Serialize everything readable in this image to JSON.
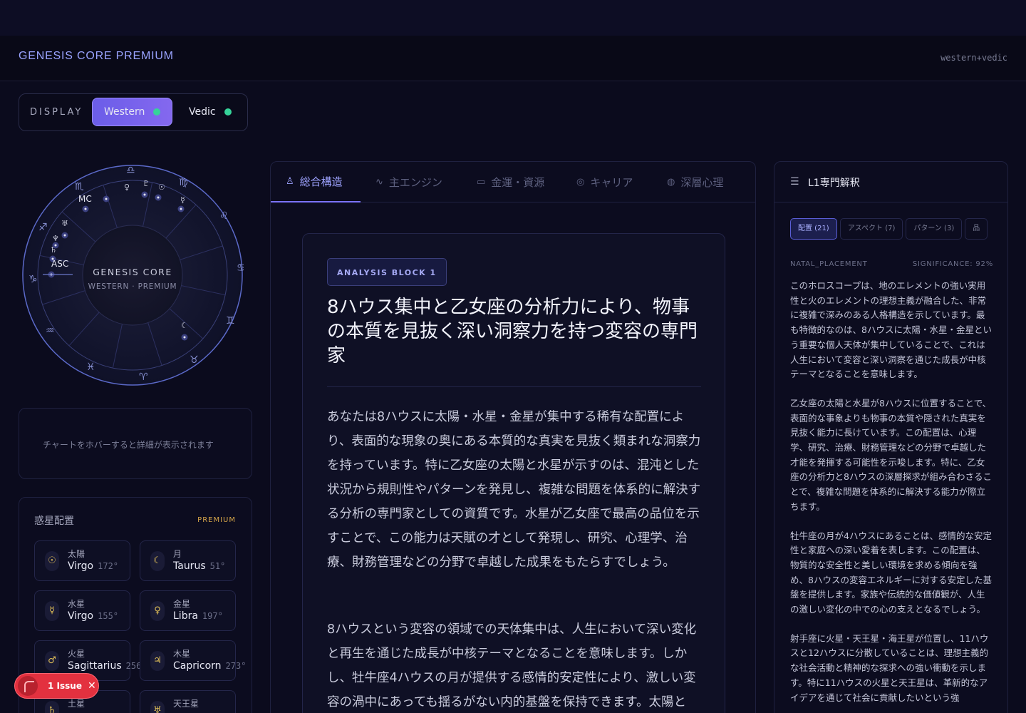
{
  "header": {
    "brand": "GENESIS CORE PREMIUM",
    "mode_tag": "western+vedic"
  },
  "display": {
    "label": "DISPLAY",
    "options": [
      {
        "label": "Western",
        "active": true
      },
      {
        "label": "Vedic",
        "active": false
      }
    ],
    "dot_color": "#36d399"
  },
  "wheel": {
    "center_title": "GENESIS CORE",
    "center_subtitle": "WESTERN · PREMIUM",
    "asc_label": "ASC",
    "mc_label": "MC",
    "signs": [
      "♎",
      "♍",
      "♌",
      "♋",
      "♊",
      "♉",
      "♈",
      "♓",
      "♒",
      "♑",
      "♐",
      "♏"
    ],
    "planet_glyphs": [
      "♀",
      "♇",
      "☉",
      "☿",
      "♅",
      "♆",
      "♄",
      "☾"
    ]
  },
  "hover_hint": "チャートをホバーすると詳細が表示されます",
  "planets": {
    "title": "惑星配置",
    "badge": "PREMIUM",
    "items": [
      {
        "glyph": "☉",
        "name": "太陽",
        "sign": "Virgo",
        "degree": "172°"
      },
      {
        "glyph": "☾",
        "name": "月",
        "sign": "Taurus",
        "degree": "51°"
      },
      {
        "glyph": "☿",
        "name": "水星",
        "sign": "Virgo",
        "degree": "155°"
      },
      {
        "glyph": "♀",
        "name": "金星",
        "sign": "Libra",
        "degree": "197°"
      },
      {
        "glyph": "♂",
        "name": "火星",
        "sign": "Sagittarius",
        "degree": "256°"
      },
      {
        "glyph": "♃",
        "name": "木星",
        "sign": "Capricorn",
        "degree": "273°"
      },
      {
        "glyph": "♄",
        "name": "土星",
        "sign": "",
        "degree": ""
      },
      {
        "glyph": "♅",
        "name": "天王星",
        "sign": "",
        "degree": ""
      }
    ]
  },
  "issue": {
    "label": "1 Issue",
    "close": "✕"
  },
  "tabs": [
    {
      "icon": "person-icon",
      "glyph": "♙",
      "label": "総合構造",
      "active": true
    },
    {
      "icon": "activity-icon",
      "glyph": "∿",
      "label": "主エンジン",
      "active": false
    },
    {
      "icon": "wallet-icon",
      "glyph": "▭",
      "label": "金運・資源",
      "active": false
    },
    {
      "icon": "target-icon",
      "glyph": "◎",
      "label": "キャリア",
      "active": false
    },
    {
      "icon": "brain-icon",
      "glyph": "◍",
      "label": "深層心理",
      "active": false
    }
  ],
  "article": {
    "badge": "ANALYSIS BLOCK 1",
    "title": "8ハウス集中と乙女座の分析力により、物事の本質を見抜く深い洞察力を持つ変容の専門家",
    "paragraphs": [
      "あなたは8ハウスに太陽・水星・金星が集中する稀有な配置により、表面的な現象の奥にある本質的な真実を見抜く類まれな洞察力を持っています。特に乙女座の太陽と水星が示すのは、混沌とした状況から規則性やパターンを発見し、複雑な問題を体系的に解決する分析の専門家としての資質です。水星が乙女座で最高の品位を示すことで、この能力は天賦の才として発現し、研究、心理学、治療、財務管理などの分野で卓越した成果をもたらすでしょう。",
      "8ハウスという変容の領域での天体集中は、人生において深い変化と再生を通じた成長が中核テーマとなることを意味します。しかし、牡牛座4ハウスの月が提供する感情的安定性により、激しい変容の渦中にあっても揺るがない内的基盤を保持できます。太陽と"
    ]
  },
  "right_panel": {
    "title": "L1専門解釈",
    "chips": [
      {
        "label": "配置 (21)",
        "active": true
      },
      {
        "label": "アスペクト (7)",
        "active": false
      },
      {
        "label": "パターン (3)",
        "active": false
      },
      {
        "label": "品",
        "active": false
      }
    ],
    "meta_left": "NATAL_PLACEMENT",
    "meta_right": "SIGNIFICANCE: 92%",
    "paragraphs": [
      "このホロスコープは、地のエレメントの強い実用性と火のエレメントの理想主義が融合した、非常に複雑で深みのある人格構造を示しています。最も特徴的なのは、8ハウスに太陽・水星・金星という重要な個人天体が集中していることで、これは人生において変容と深い洞察を通じた成長が中核テーマとなることを意味します。",
      "乙女座の太陽と水星が8ハウスに位置することで、表面的な事象よりも物事の本質や隠された真実を見抜く能力に長けています。この配置は、心理学、研究、治療、財務管理などの分野で卓越した才能を発揮する可能性を示唆します。特に、乙女座の分析力と8ハウスの深層探求が組み合わさることで、複雑な問題を体系的に解決する能力が際立ちます。",
      "牡牛座の月が4ハウスにあることは、感情的な安定性と家庭への深い愛着を表します。この配置は、物質的な安全性と美しい環境を求める傾向を強め、8ハウスの変容エネルギーに対する安定した基盤を提供します。家族や伝統的な価値観が、人生の激しい変化の中での心の支えとなるでしょう。",
      "射手座に火星・天王星・海王星が位置し、11ハウスと12ハウスに分散していることは、理想主義的な社会活動と精神的な探求への強い衝動を示します。特に11ハウスの火星と天王星は、革新的なアイデアを通じて社会に貢献したいという強"
    ]
  },
  "colors": {
    "accent": "#7c73ff",
    "premium": "#d6a64a",
    "issue": "#e3313f"
  }
}
